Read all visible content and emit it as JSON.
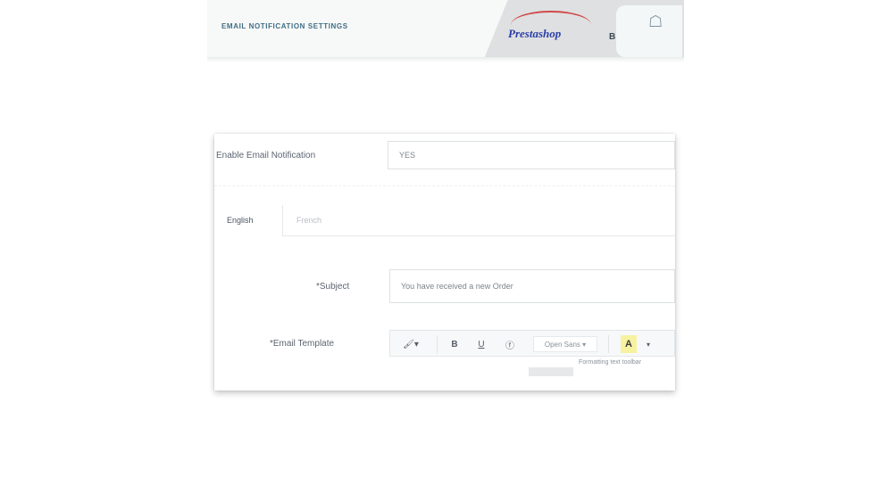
{
  "header": {
    "title": "EMAIL NOTIFICATION SETTINGS",
    "brand_logo": "Prestashop",
    "badge_small": "B"
  },
  "form": {
    "enable_label": "Enable Email Notification",
    "enable_value": "YES",
    "tabs": [
      {
        "label": "English",
        "active": true
      },
      {
        "label": "French",
        "active": false
      }
    ],
    "subject_label": "*Subject",
    "subject_value": "You have received a new Order",
    "template_label": "*Email Template",
    "toolbar": {
      "paint_label": "🖌▾",
      "bold_label": "B",
      "underline_label": "U",
      "clear_label": "ⓕ",
      "font_label": "Open Sans ▾",
      "highlight_label": "A",
      "highlight_caret": "▾"
    },
    "hint_text": "Formatting text toolbar"
  }
}
